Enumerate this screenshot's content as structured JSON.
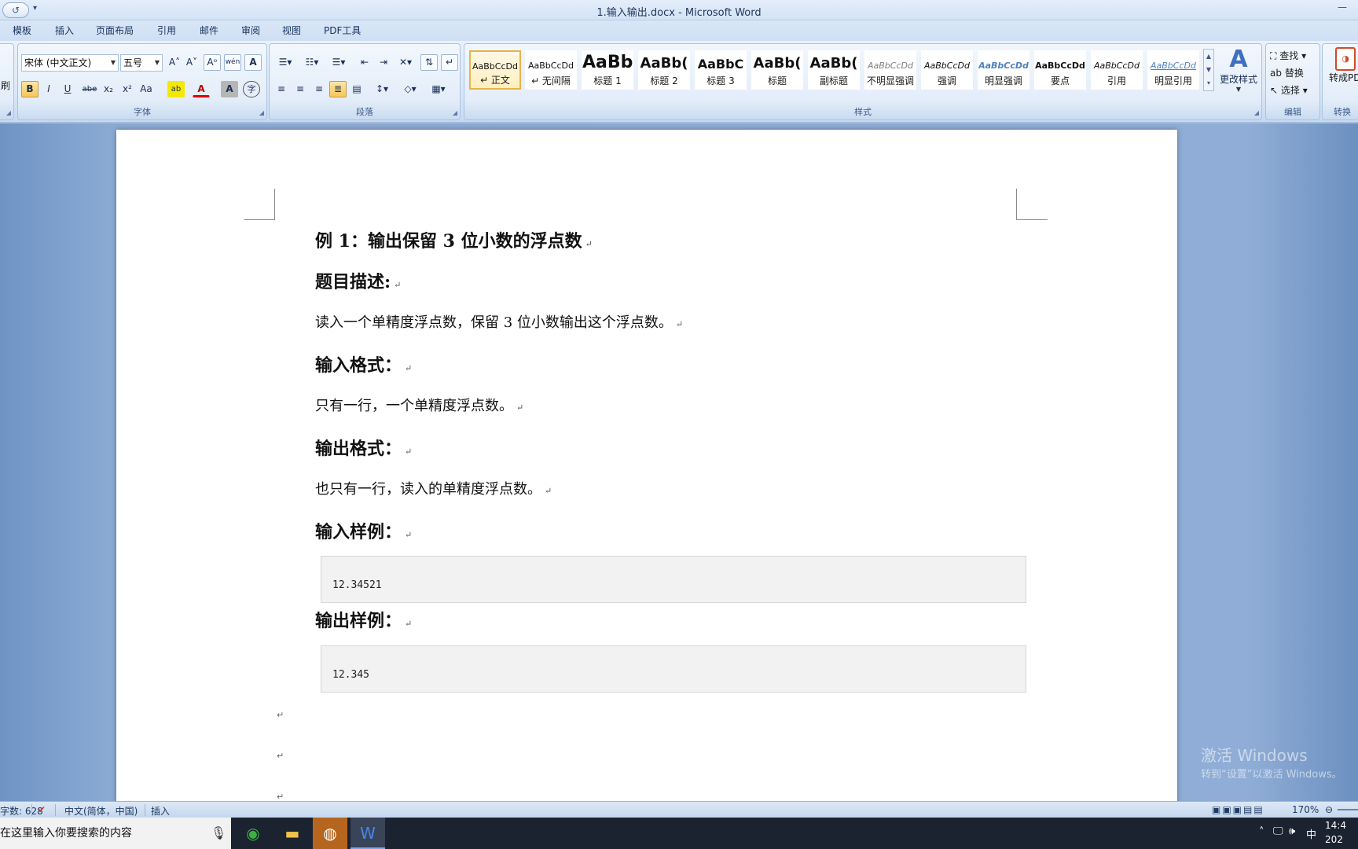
{
  "window": {
    "title": "1.输入输出.docx - Microsoft Word",
    "minimize_glyph": "—"
  },
  "qat": {
    "undo": "↺",
    "more": "▾"
  },
  "tabs": [
    "模板",
    "插入",
    "页面布局",
    "引用",
    "邮件",
    "审阅",
    "视图",
    "PDF工具"
  ],
  "ribbon": {
    "clipboard_partial": "刷",
    "font": {
      "name": "宋体 (中文正文)",
      "size": "五号",
      "label": "字体",
      "grow": "A˄",
      "shrink": "A˅",
      "clear": "Aᵒ",
      "phonetic": "wén",
      "border_char": "A",
      "bold": "B",
      "italic": "I",
      "underline": "U",
      "strike": "abe",
      "subscript": "x₂",
      "superscript": "x²",
      "case": "Aa",
      "highlight": "ab",
      "font_color": "A",
      "shading": "A",
      "enclose": "字"
    },
    "paragraph": {
      "label": "段落"
    },
    "styles": {
      "label": "样式",
      "items": [
        {
          "sample": "AaBbCcDd",
          "name": "↵ 正文",
          "active": true
        },
        {
          "sample": "AaBbCcDd",
          "name": "↵ 无间隔",
          "active": false
        },
        {
          "sample": "AaBb",
          "name": "标题 1",
          "active": false
        },
        {
          "sample": "AaBb(",
          "name": "标题 2",
          "active": false
        },
        {
          "sample": "AaBbC",
          "name": "标题 3",
          "active": false
        },
        {
          "sample": "AaBb(",
          "name": "标题",
          "active": false
        },
        {
          "sample": "AaBb(",
          "name": "副标题",
          "active": false
        },
        {
          "sample": "AaBbCcDd",
          "name": "不明显强调",
          "active": false
        },
        {
          "sample": "AaBbCcDd",
          "name": "强调",
          "active": false
        },
        {
          "sample": "AaBbCcDd",
          "name": "明显强调",
          "active": false
        },
        {
          "sample": "AaBbCcDd",
          "name": "要点",
          "active": false
        },
        {
          "sample": "AaBbCcDd",
          "name": "引用",
          "active": false
        },
        {
          "sample": "AaBbCcDd",
          "name": "明显引用",
          "active": false
        }
      ],
      "change_styles": "更改样式"
    },
    "editing": {
      "label": "编辑",
      "find": "查找",
      "replace": "替换",
      "select": "选择"
    },
    "convert": {
      "label": "转换",
      "to_pdf": "转成PD"
    }
  },
  "document": {
    "lines": [
      {
        "kind": "h",
        "text": "例 1：输出保留 3 位小数的浮点数"
      },
      {
        "kind": "h",
        "text": "题目描述:"
      },
      {
        "kind": "p",
        "text": "读入一个单精度浮点数，保留 3 位小数输出这个浮点数。"
      },
      {
        "kind": "h",
        "text": "输入格式："
      },
      {
        "kind": "p",
        "text": "只有一行，一个单精度浮点数。"
      },
      {
        "kind": "h",
        "text": "输出格式："
      },
      {
        "kind": "p",
        "text": "也只有一行，读入的单精度浮点数。"
      },
      {
        "kind": "h",
        "text": "输入样例："
      },
      {
        "kind": "h",
        "text": "输出样例："
      }
    ],
    "input_sample": "12.34521",
    "output_sample": "12.345",
    "paragraph_mark": "↵"
  },
  "watermark": {
    "line1": "激活 Windows",
    "line2": "转到“设置”以激活 Windows。"
  },
  "status": {
    "words": "字数: 628",
    "language": "中文(简体，中国)",
    "mode": "插入",
    "zoom": "170%"
  },
  "taskbar": {
    "search_placeholder": "在这里输入你要搜索的内容",
    "time": "14:4",
    "date": "202",
    "ime": "中"
  }
}
